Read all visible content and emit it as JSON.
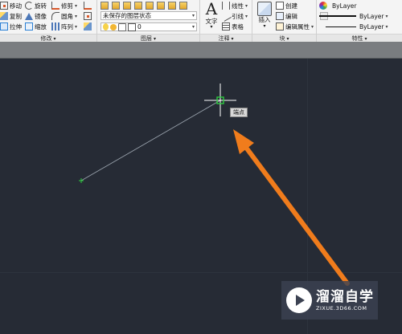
{
  "modify_panel": {
    "title": "修改",
    "tools": {
      "move": "移动",
      "rotate": "旋转",
      "trim": "修剪",
      "copy": "复制",
      "mirror": "镜像",
      "fillet": "圆角",
      "stretch": "拉伸",
      "scale": "缩放",
      "array": "阵列"
    }
  },
  "layers_panel": {
    "title": "图层",
    "layer_state": "未保存的图层状态",
    "current_layer": "0"
  },
  "annotation_panel": {
    "title": "注释",
    "text": "文字",
    "linear": "线性",
    "leader": "引线",
    "table": "表格",
    "big_letter": "A"
  },
  "block_panel": {
    "title": "块",
    "insert": "插入",
    "create": "创建",
    "edit": "编辑",
    "edit_attributes": "编辑属性"
  },
  "properties_panel": {
    "title": "特性",
    "color": "ByLayer",
    "linetype": "ByLayer",
    "lineweight": "ByLayer"
  },
  "canvas": {
    "tooltip": "端点",
    "line_color": "#9aa3ad",
    "crosshair_color": "#ffffff",
    "marker_color": "#2ecc40",
    "arrow_color": "#f07c1c",
    "background": "#262b35"
  },
  "watermark": {
    "title": "溜溜自学",
    "url": "ZIXUE.3D66.COM"
  },
  "dropdown_arrow": "▾"
}
